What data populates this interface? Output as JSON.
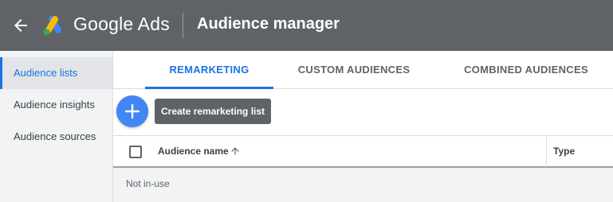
{
  "header": {
    "brand": "Google Ads",
    "title": "Audience manager",
    "back_icon": "arrow-back-icon",
    "logo_icon": "google-ads-logo",
    "bg_color": "#5f6368"
  },
  "sidebar": {
    "items": [
      {
        "label": "Audience lists",
        "active": true
      },
      {
        "label": "Audience insights",
        "active": false
      },
      {
        "label": "Audience sources",
        "active": false
      }
    ]
  },
  "tabs": [
    {
      "label": "REMARKETING",
      "active": true
    },
    {
      "label": "CUSTOM AUDIENCES",
      "active": false
    },
    {
      "label": "COMBINED AUDIENCES",
      "active": false
    }
  ],
  "create": {
    "fab_icon": "add-icon",
    "tooltip": "Create remarketing list",
    "accent": "#4285f4"
  },
  "table": {
    "columns": [
      "Audience name",
      "Type"
    ],
    "sort_icon": "arrow-upward-icon",
    "group_row": "Not in-use"
  },
  "colors": {
    "active_blue": "#1a73e8"
  }
}
